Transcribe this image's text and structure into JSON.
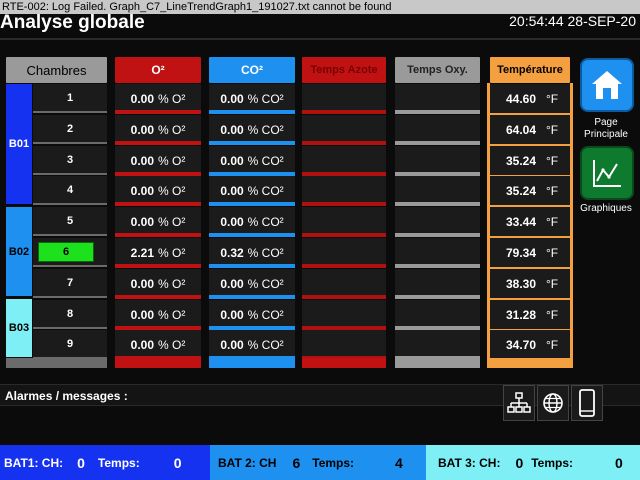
{
  "error_banner": "RTE-002: Log Failed. Graph_C7_LineTrendGraph1_191027.txt cannot be found",
  "header": {
    "title": "Analyse globale",
    "datetime": "20:54:44 28-SEP-20"
  },
  "columns": {
    "chambres": "Chambres",
    "o2": "O²",
    "co2": "CO²",
    "azote": "Temps Azote",
    "oxy": "Temps Oxy.",
    "temp": "Température"
  },
  "colors": {
    "o2": "#c01212",
    "co2": "#1e90f0",
    "azote": "#b01010",
    "oxy": "#9a9a9a",
    "temp": "#f5a040",
    "bat1": "#1432f0",
    "bat2": "#1e90f0",
    "bat3": "#7ef0f5",
    "active_chamber": "#1ee11e"
  },
  "batteries": [
    {
      "label": "B01",
      "color": "#1432f0"
    },
    {
      "label": "B02",
      "color": "#1e90f0"
    },
    {
      "label": "B03",
      "color": "#7ef0f5"
    }
  ],
  "rows": [
    {
      "chamber": "1",
      "o2": "0.00",
      "o2_unit": "% O²",
      "co2": "0.00",
      "co2_unit": "% CO²",
      "temp": "44.60",
      "temp_unit": "°F"
    },
    {
      "chamber": "2",
      "o2": "0.00",
      "o2_unit": "% O²",
      "co2": "0.00",
      "co2_unit": "% CO²",
      "temp": "64.04",
      "temp_unit": "°F"
    },
    {
      "chamber": "3",
      "o2": "0.00",
      "o2_unit": "% O²",
      "co2": "0.00",
      "co2_unit": "% CO²",
      "temp": "35.24",
      "temp_unit": "°F"
    },
    {
      "chamber": "4",
      "o2": "0.00",
      "o2_unit": "% O²",
      "co2": "0.00",
      "co2_unit": "% CO²",
      "temp": "35.24",
      "temp_unit": "°F"
    },
    {
      "chamber": "5",
      "o2": "0.00",
      "o2_unit": "% O²",
      "co2": "0.00",
      "co2_unit": "% CO²",
      "temp": "33.44",
      "temp_unit": "°F"
    },
    {
      "chamber": "6",
      "o2": "2.21",
      "o2_unit": "% O²",
      "co2": "0.32",
      "co2_unit": "% CO²",
      "temp": "79.34",
      "temp_unit": "°F"
    },
    {
      "chamber": "7",
      "o2": "0.00",
      "o2_unit": "% O²",
      "co2": "0.00",
      "co2_unit": "% CO²",
      "temp": "38.30",
      "temp_unit": "°F"
    },
    {
      "chamber": "8",
      "o2": "0.00",
      "o2_unit": "% O²",
      "co2": "0.00",
      "co2_unit": "% CO²",
      "temp": "31.28",
      "temp_unit": "°F"
    },
    {
      "chamber": "9",
      "o2": "0.00",
      "o2_unit": "% O²",
      "co2": "0.00",
      "co2_unit": "% CO²",
      "temp": "34.70",
      "temp_unit": "°F"
    }
  ],
  "active_chamber": "6",
  "nav": {
    "home_label_1": "Page",
    "home_label_2": "Principale",
    "home_icon": "home-icon",
    "graphs_label": "Graphiques",
    "graphs_icon": "line-chart-icon"
  },
  "alarms": {
    "label": "Alarmes / messages :"
  },
  "toolbar_icons": [
    "network-icon",
    "globe-icon",
    "mobile-phone-icon"
  ],
  "footer": {
    "bat1": {
      "ch_label": "BAT1: CH:",
      "ch": "0",
      "temps_label": "Temps:",
      "temps": "0",
      "color": "#1432f0"
    },
    "bat2": {
      "ch_label": "BAT 2: CH",
      "ch": "6",
      "temps_label": "Temps:",
      "temps": "4",
      "color": "#1e90f0"
    },
    "bat3": {
      "ch_label": "BAT 3: CH:",
      "ch": "0",
      "temps_label": "Temps:",
      "temps": "0",
      "color": "#7ef0f5"
    }
  }
}
